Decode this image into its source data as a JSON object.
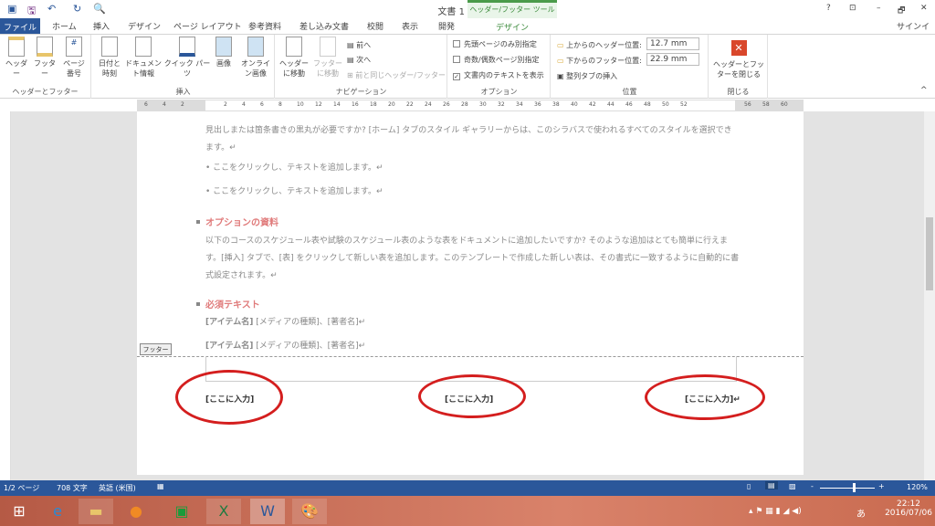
{
  "title": "文書 1 - Word",
  "window_controls": {
    "help": "?",
    "ribbon_opts": "⊡",
    "minimize": "–",
    "restore": "🗗",
    "close": "✕",
    "signin": "サインイン"
  },
  "tabs": {
    "file": "ファイル",
    "items": [
      "ホーム",
      "挿入",
      "デザイン",
      "ページ レイアウト",
      "参考資料",
      "差し込み文書",
      "校閲",
      "表示",
      "開発"
    ],
    "context_title": "ヘッダー/フッター ツール",
    "context_tab": "デザイン"
  },
  "ribbon": {
    "hf": {
      "label": "ヘッダーとフッター",
      "header": "ヘッダー",
      "footer": "フッター",
      "pagenum": "ページ番号"
    },
    "insert": {
      "label": "挿入",
      "date": "日付と時刻",
      "docinfo": "ドキュメント情報",
      "quick": "クイック パーツ",
      "image": "画像",
      "online": "オンライン画像"
    },
    "nav": {
      "label": "ナビゲーション",
      "goheader": "ヘッダーに移動",
      "gofooter": "フッターに移動",
      "prev": "前へ",
      "next": "次へ",
      "same": "前と同じヘッダー/フッター"
    },
    "options": {
      "label": "オプション",
      "first": "先頭ページのみ別指定",
      "oddeven": "奇数/偶数ページ別指定",
      "showtext": "文書内のテキストを表示",
      "showtext_checked": true
    },
    "position": {
      "label": "位置",
      "header_pos_label": "上からのヘッダー位置:",
      "header_pos": "12.7 mm",
      "footer_pos_label": "下からのフッター位置:",
      "footer_pos": "22.9 mm",
      "align_tab": "整列タブの挿入"
    },
    "close": {
      "label": "閉じる",
      "button": "ヘッダーとフッターを閉じる"
    }
  },
  "ruler": [
    "6",
    "4",
    "2",
    "2",
    "4",
    "6",
    "8",
    "10",
    "12",
    "14",
    "16",
    "18",
    "20",
    "22",
    "24",
    "26",
    "28",
    "30",
    "32",
    "34",
    "36",
    "38",
    "40",
    "42",
    "44",
    "46",
    "48",
    "50",
    "52",
    "56",
    "58",
    "60"
  ],
  "document": {
    "para1": "見出しまたは箇条書きの黒丸が必要ですか? [ホーム] タブのスタイル ギャラリーからは、このシラバスで使われるすべてのスタイルを選択できます。↵",
    "bullet1": "• ここをクリックし、テキストを追加します。↵",
    "bullet2": "• ここをクリックし、テキストを追加します。↵",
    "heading1": "オプションの資料",
    "para2": "以下のコースのスケジュール表や試験のスケジュール表のような表をドキュメントに追加したいですか? そのような追加はとても簡単に行えます。[挿入] タブで、[表] をクリックして新しい表を追加します。このテンプレートで作成した新しい表は、その書式に一致するように自動的に書式設定されます。↵",
    "heading2": "必須テキスト",
    "item_bold": "[アイテム名]",
    "item_rest": " [メディアの種類]、[著者名]↵",
    "footer_tag": "フッター",
    "footer_left": "[ここに入力]",
    "footer_center": "[ここに入力]",
    "footer_right": "[ここに入力]↵"
  },
  "status": {
    "page": "1/2 ページ",
    "words": "708 文字",
    "lang": "英語 (米国)",
    "zoom": "120%"
  },
  "taskbar": {
    "time": "22:12",
    "date": "2016/07/06",
    "ime": "あ"
  },
  "colors": {
    "accent": "#2b579a",
    "context": "#4a9b4a",
    "heading": "#e07b7b",
    "annotation": "#d41e1e"
  }
}
